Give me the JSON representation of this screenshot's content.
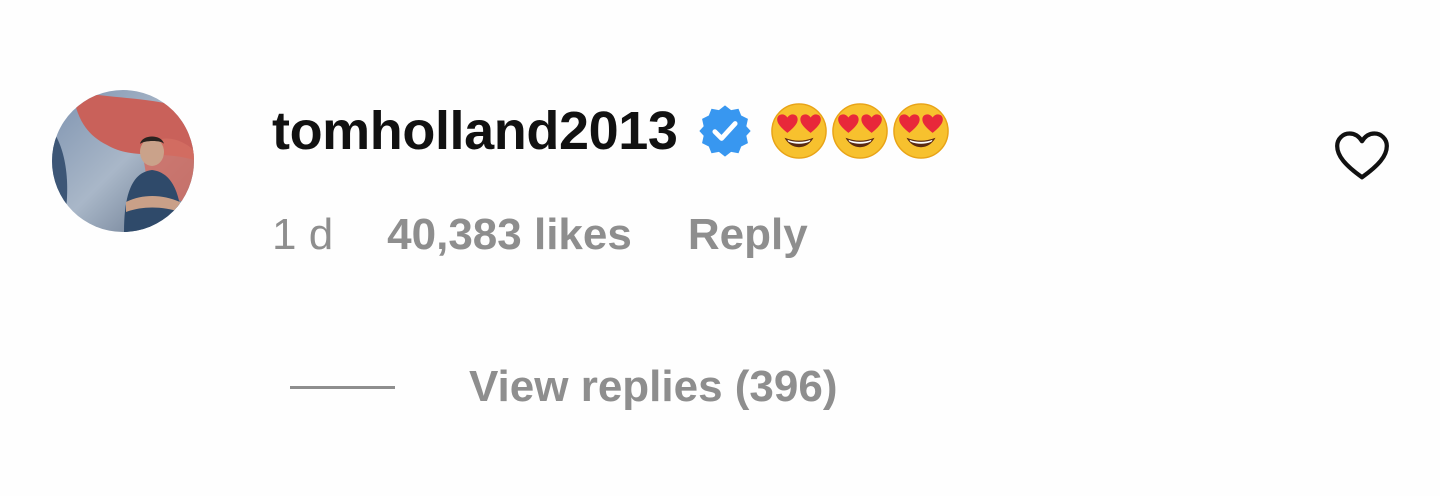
{
  "comment": {
    "username": "tomholland2013",
    "verified_icon": "verified-badge-icon",
    "emojis": [
      "😍",
      "😍",
      "😍"
    ],
    "time": "1 d",
    "likes": "40,383 likes",
    "reply_label": "Reply",
    "like_icon": "heart-outline-icon",
    "view_replies_label": "View replies (396)"
  },
  "colors": {
    "username": "#111111",
    "meta": "#8e8e8e",
    "verified": "#3897f0",
    "background": "#fefefe"
  }
}
